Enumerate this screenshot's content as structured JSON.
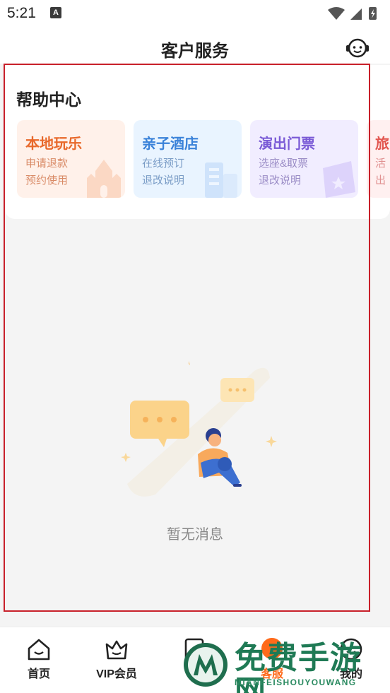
{
  "status": {
    "time": "5:21",
    "notif_letter": "A"
  },
  "header": {
    "title": "客户服务"
  },
  "help": {
    "title": "帮助中心",
    "cards": [
      {
        "title": "本地玩乐",
        "line1": "申请退款",
        "line2": "预约使用"
      },
      {
        "title": "亲子酒店",
        "line1": "在线预订",
        "line2": "退改说明"
      },
      {
        "title": "演出门票",
        "line1": "选座&取票",
        "line2": "退改说明"
      },
      {
        "title": "旅",
        "line1": "活",
        "line2": "出"
      }
    ]
  },
  "empty": {
    "text": "暂无消息"
  },
  "tabs": [
    {
      "label": "首页",
      "icon": "home-icon"
    },
    {
      "label": "VIP会员",
      "icon": "crown-icon"
    },
    {
      "label": "",
      "icon": "ticket-icon"
    },
    {
      "label": "客服",
      "icon": "service-icon",
      "active": true
    },
    {
      "label": "我的",
      "icon": "profile-icon"
    }
  ],
  "watermark": {
    "title": "免费手游网",
    "subtitle": "MIANFEISHOUYOUWANG"
  },
  "colors": {
    "accent": "#ff6a1a",
    "frame": "#c8202a",
    "watermark": "#1f7a55"
  }
}
